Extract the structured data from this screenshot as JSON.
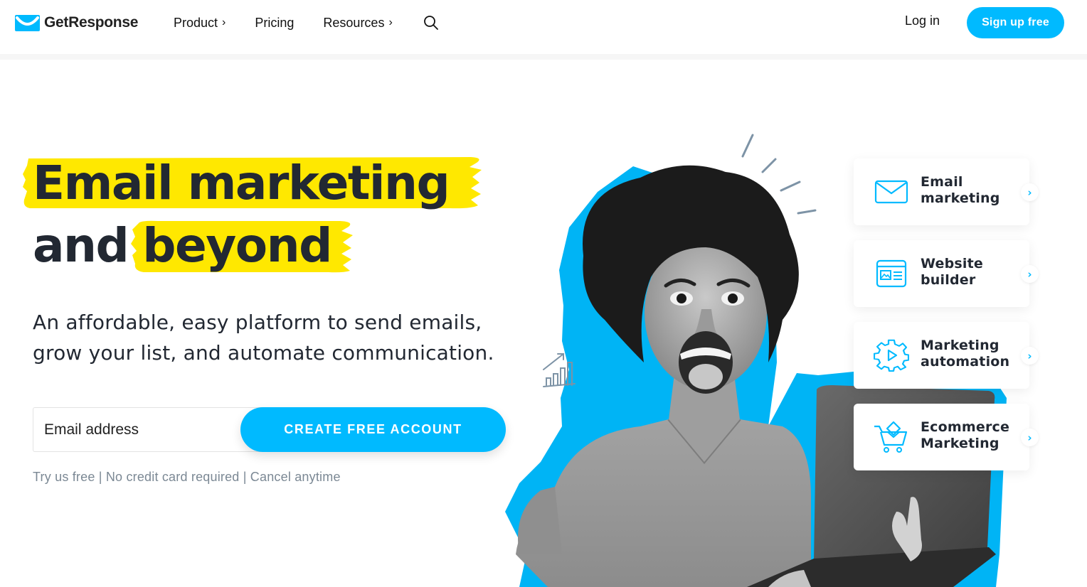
{
  "header": {
    "brand": "GetResponse",
    "nav": [
      {
        "label": "Product",
        "has_chevron": true
      },
      {
        "label": "Pricing",
        "has_chevron": false
      },
      {
        "label": "Resources",
        "has_chevron": true
      }
    ],
    "chevron_glyph": "›",
    "search_icon": "search-icon",
    "login_label": "Log in",
    "signup_label": "Sign up free"
  },
  "hero": {
    "headline_line1": "Email marketing",
    "headline_line2_plain": "and",
    "headline_line2_highlight": "beyond",
    "subheadline": "An affordable, easy platform to send emails, grow your list, and automate communication.",
    "email_placeholder": "Email address",
    "email_value": "",
    "cta_label": "CREATE FREE ACCOUNT",
    "disclaimer": "Try us free | No credit card required | Cancel anytime"
  },
  "features": [
    {
      "label_line1": "Email",
      "label_line2": "marketing",
      "icon": "envelope-icon"
    },
    {
      "label_line1": "Website",
      "label_line2": "builder",
      "icon": "website-icon"
    },
    {
      "label_line1": "Marketing",
      "label_line2": "automation",
      "icon": "gear-play-icon"
    },
    {
      "label_line1": "Ecommerce",
      "label_line2": "Marketing",
      "icon": "shopping-cart-icon"
    }
  ],
  "arrow_glyph": "›",
  "colors": {
    "accent": "#00baff",
    "highlight": "#ffe800",
    "text_dark": "#222832",
    "muted": "#7b8894",
    "decor_lines": "#7d93a6"
  }
}
